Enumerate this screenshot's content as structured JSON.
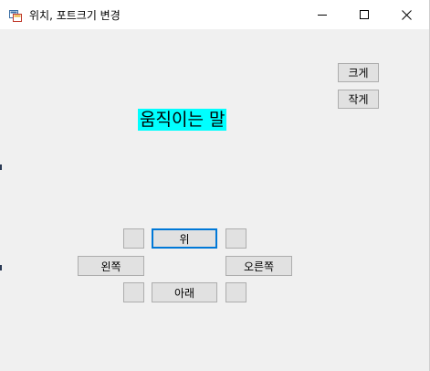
{
  "window": {
    "title": "위치, 포트크기 변경",
    "minimize_icon": "minimize-icon",
    "maximize_icon": "maximize-icon",
    "close_icon": "close-icon"
  },
  "controls": {
    "bigger_label": "크게",
    "smaller_label": "작게",
    "moving_text": "움직이는 말",
    "up_label": "위",
    "left_label": "왼쪽",
    "right_label": "오른쪽",
    "down_label": "아래",
    "blank_label": ""
  },
  "colors": {
    "label_background": "#00ffff",
    "focus_border": "#0078d7",
    "window_background": "#f0f0f0"
  }
}
